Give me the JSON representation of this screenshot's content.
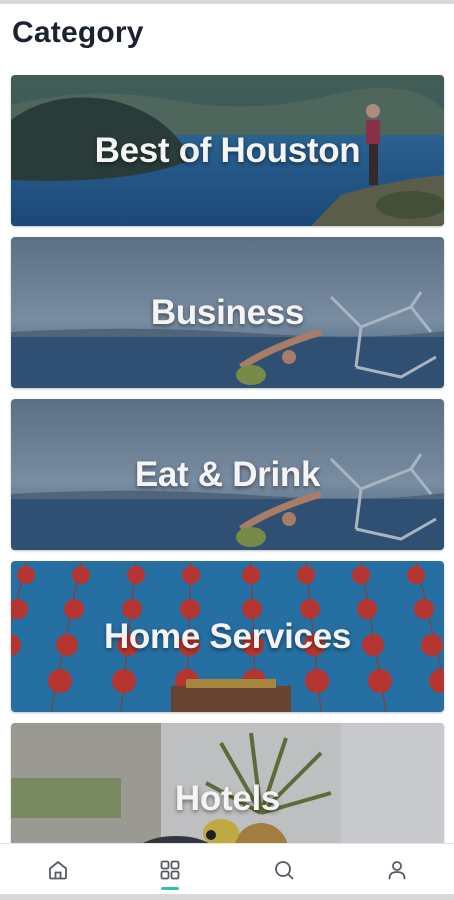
{
  "header": {
    "title": "Category"
  },
  "categories": [
    {
      "label": "Best of Houston",
      "image": "crater-lake-hiker"
    },
    {
      "label": "Business",
      "image": "lake-yoga"
    },
    {
      "label": "Eat & Drink",
      "image": "lake-yoga"
    },
    {
      "label": "Home Services",
      "image": "red-lanterns"
    },
    {
      "label": "Hotels",
      "image": "tropical-toucan"
    }
  ],
  "tabbar": {
    "tabs": [
      {
        "name": "home",
        "icon": "home-icon",
        "active": false
      },
      {
        "name": "categories",
        "icon": "grid-icon",
        "active": true
      },
      {
        "name": "search",
        "icon": "search-icon",
        "active": false
      },
      {
        "name": "profile",
        "icon": "user-icon",
        "active": false
      }
    ]
  },
  "colors": {
    "title": "#1c2330",
    "active_tab": "#2cc4a8",
    "tab_icon": "#555b66"
  }
}
